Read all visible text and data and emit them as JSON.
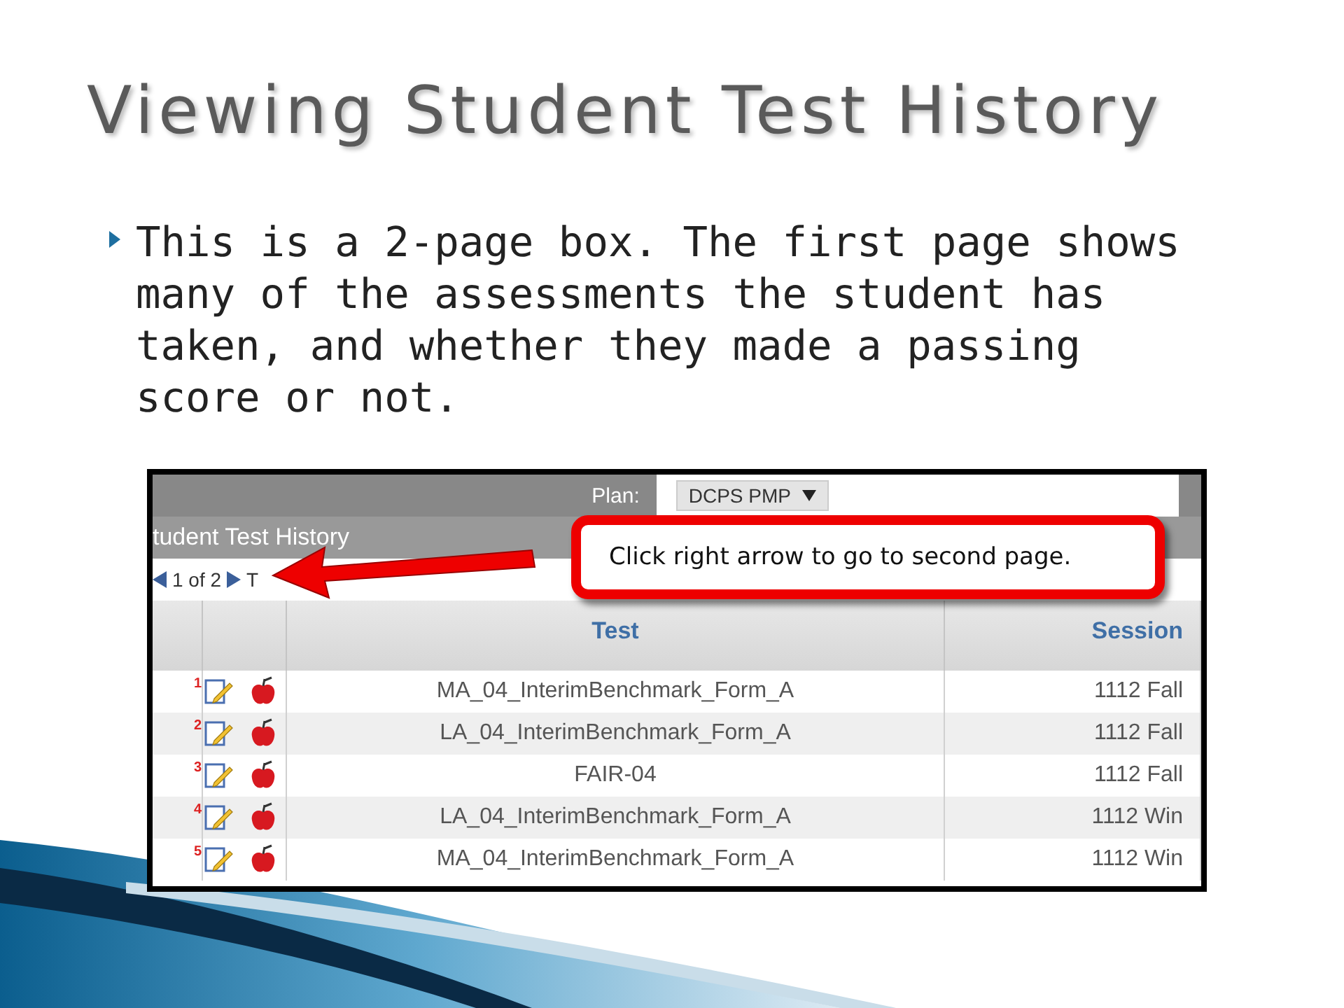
{
  "slide": {
    "title": "Viewing Student Test History",
    "bullets": [
      "This is a 2-page box. The first page shows many of the assessments the student has taken, and whether they made a passing score or not."
    ]
  },
  "screenshot": {
    "plan_label": "Plan:",
    "plan_value": "DCPS PMP",
    "panel_title": "tudent Test History",
    "pager": {
      "text": "1 of 2",
      "cut_label": "T"
    },
    "columns": [
      {
        "label": "Test"
      },
      {
        "label": "Session"
      }
    ],
    "rows": [
      {
        "number": "1",
        "test": "MA_04_InterimBenchmark_Form_A",
        "session": "1112 Fall"
      },
      {
        "number": "2",
        "test": "LA_04_InterimBenchmark_Form_A",
        "session": "1112 Fall"
      },
      {
        "number": "3",
        "test": "FAIR-04",
        "session": "1112 Fall"
      },
      {
        "number": "4",
        "test": "LA_04_InterimBenchmark_Form_A",
        "session": "1112 Win"
      },
      {
        "number": "5",
        "test": "MA_04_InterimBenchmark_Form_A",
        "session": "1112 Win"
      }
    ],
    "callout": "Click right arrow to go to second page."
  }
}
